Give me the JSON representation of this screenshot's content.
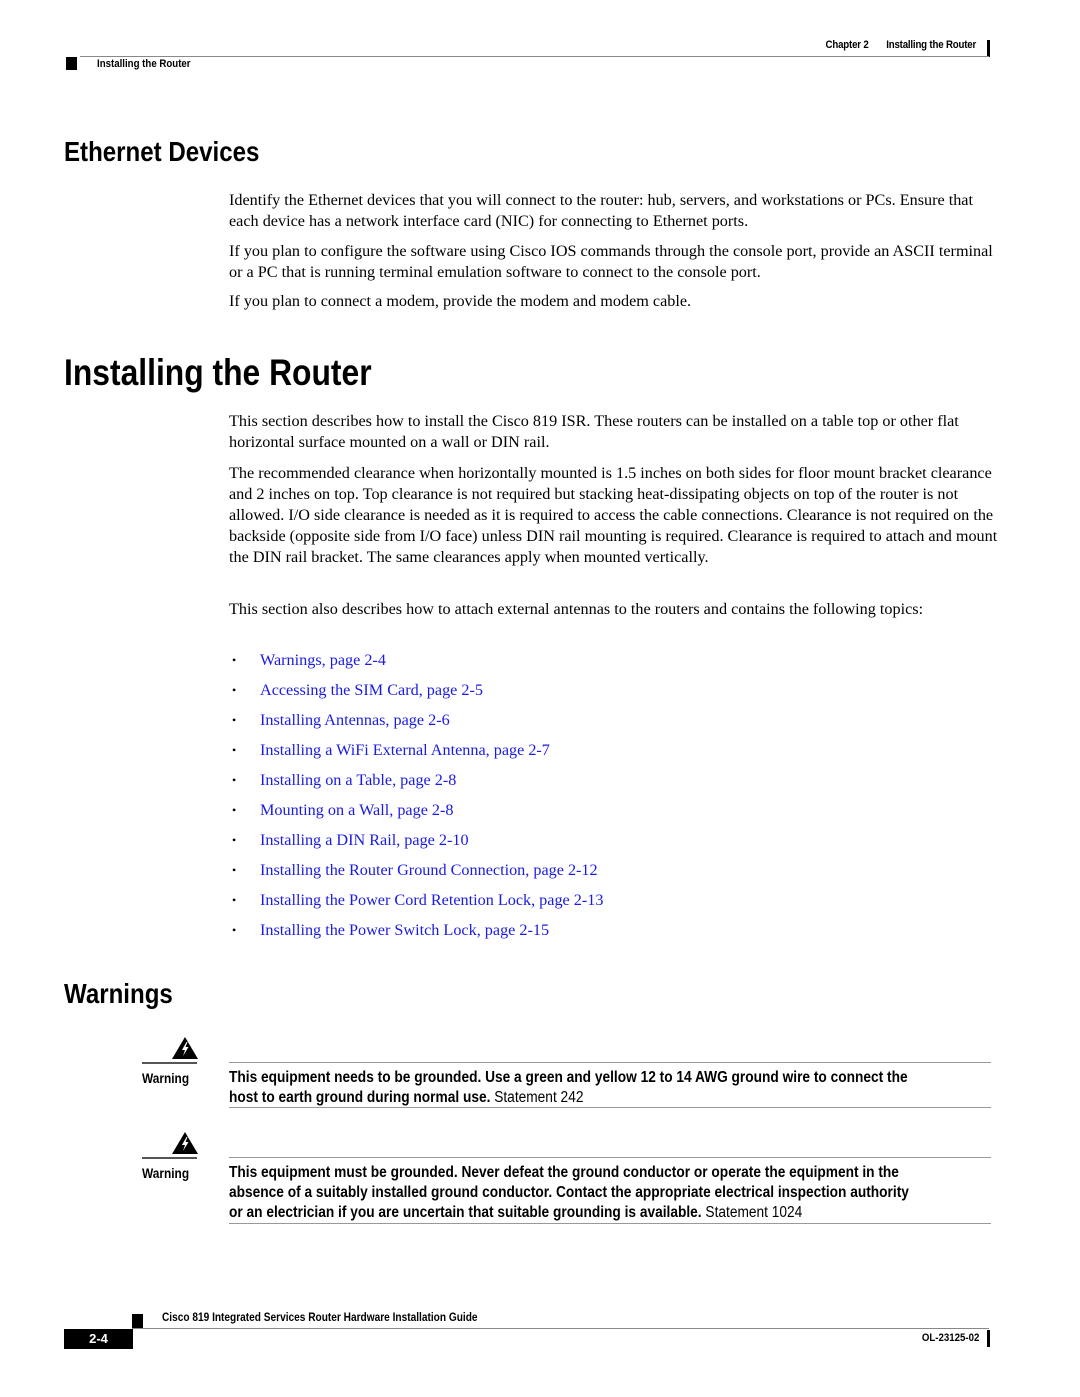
{
  "header": {
    "chapter_label": "Chapter 2",
    "chapter_title": "Installing the Router",
    "section_title": "Installing the Router"
  },
  "sections": {
    "ethernet": {
      "heading": "Ethernet Devices",
      "paragraphs": [
        "Identify the Ethernet devices that you will connect to the router: hub, servers, and workstations or PCs. Ensure that each device has a network interface card (NIC) for connecting to Ethernet ports.",
        "If you plan to configure the software using Cisco IOS commands through the console port, provide an ASCII terminal or a PC that is running terminal emulation software to connect to the console port.",
        "If you plan to connect a modem, provide the modem and modem cable."
      ]
    },
    "installing": {
      "heading": "Installing the Router",
      "paragraphs": [
        "This section describes how to install the Cisco 819 ISR. These routers can be installed on a table top or other flat horizontal surface mounted on a wall or DIN rail.",
        "The recommended clearance when horizontally mounted is 1.5 inches on both sides for floor mount bracket clearance and 2 inches on top. Top clearance is not required but stacking heat-dissipating objects on top of the router is not allowed. I/O side clearance is needed as it is required to access the cable connections. Clearance is not required on the backside (opposite side from I/O face) unless DIN rail mounting is required. Clearance is required to attach and mount the DIN rail bracket.  The same clearances apply when mounted vertically.",
        "This section also describes how to attach external antennas to the routers and contains the following topics:"
      ],
      "topics": [
        "Warnings, page 2-4",
        "Accessing the SIM Card, page 2-5",
        "Installing Antennas, page 2-6",
        "Installing a WiFi External Antenna, page 2-7",
        "Installing on a Table, page 2-8",
        "Mounting on a Wall, page 2-8",
        "Installing a DIN Rail, page 2-10",
        "Installing the Router Ground Connection, page 2-12",
        "Installing the Power Cord Retention Lock, page 2-13",
        "Installing the Power Switch Lock, page 2-15"
      ],
      "bullet": "•"
    },
    "warnings": {
      "heading": "Warnings",
      "items": [
        {
          "label": "Warning",
          "icon": "electrical-hazard-icon",
          "text": "This equipment needs to be grounded. Use a green and yellow 12 to 14 AWG ground wire to connect the host to earth ground during normal use.",
          "statement": "Statement 242"
        },
        {
          "label": "Warning",
          "icon": "electrical-hazard-icon",
          "text": "This equipment must be grounded. Never defeat the ground conductor or operate the equipment in the absence of a suitably installed ground conductor. Contact the appropriate electrical inspection authority or an electrician if you are uncertain that suitable grounding is available.",
          "statement": "Statement 1024"
        }
      ]
    }
  },
  "footer": {
    "guide_title": "Cisco 819 Integrated Services Router Hardware Installation Guide",
    "page_number": "2-4",
    "doc_id": "OL-23125-02"
  },
  "colors": {
    "link": "#1a1ae6",
    "rule": "#888888",
    "text": "#000000"
  }
}
